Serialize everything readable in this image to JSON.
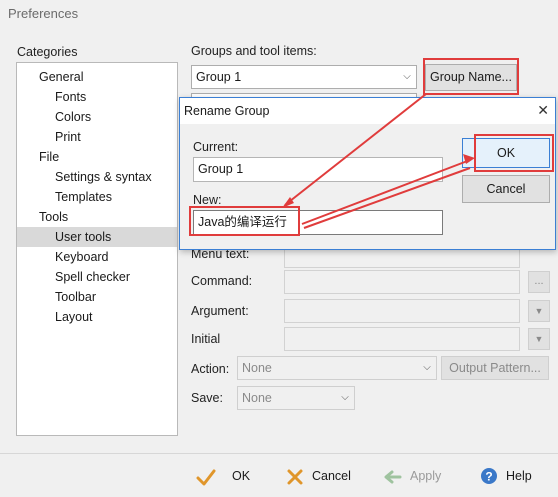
{
  "window": {
    "title": "Preferences"
  },
  "categories": {
    "label": "Categories",
    "items": [
      {
        "label": "General",
        "level": 1
      },
      {
        "label": "Fonts",
        "level": 2
      },
      {
        "label": "Colors",
        "level": 2
      },
      {
        "label": "Print",
        "level": 2
      },
      {
        "label": "File",
        "level": 1
      },
      {
        "label": "Settings & syntax",
        "level": 2
      },
      {
        "label": "Templates",
        "level": 2
      },
      {
        "label": "Tools",
        "level": 1
      },
      {
        "label": "User tools",
        "level": 2,
        "selected": true
      },
      {
        "label": "Keyboard",
        "level": 2
      },
      {
        "label": "Spell checker",
        "level": 2
      },
      {
        "label": "Toolbar",
        "level": 2
      },
      {
        "label": "Layout",
        "level": 2
      }
    ]
  },
  "groups": {
    "label": "Groups and tool items:",
    "selected_group": "Group 1",
    "group_name_button": "Group Name..."
  },
  "form": {
    "menu_text_label": "Menu text:",
    "command_label": "Command:",
    "command_browse": "...",
    "argument_label": "Argument:",
    "initial_label": "Initial",
    "action_label": "Action:",
    "action_value": "None",
    "output_pattern_button": "Output Pattern...",
    "save_label": "Save:",
    "save_value": "None"
  },
  "dialog": {
    "title": "Rename Group",
    "close": "✕",
    "current_label": "Current:",
    "current_value": "Group 1",
    "new_label": "New:",
    "new_value": "Java的编译运行",
    "ok": "OK",
    "cancel": "Cancel"
  },
  "bottom": {
    "ok": "OK",
    "cancel": "Cancel",
    "apply": "Apply",
    "help": "Help"
  },
  "colors": {
    "annotation_red": "#e03c3c",
    "dialog_border": "#3b7fd4",
    "ok_green": "#2e9e3e",
    "cancel_orange": "#e0962b"
  }
}
